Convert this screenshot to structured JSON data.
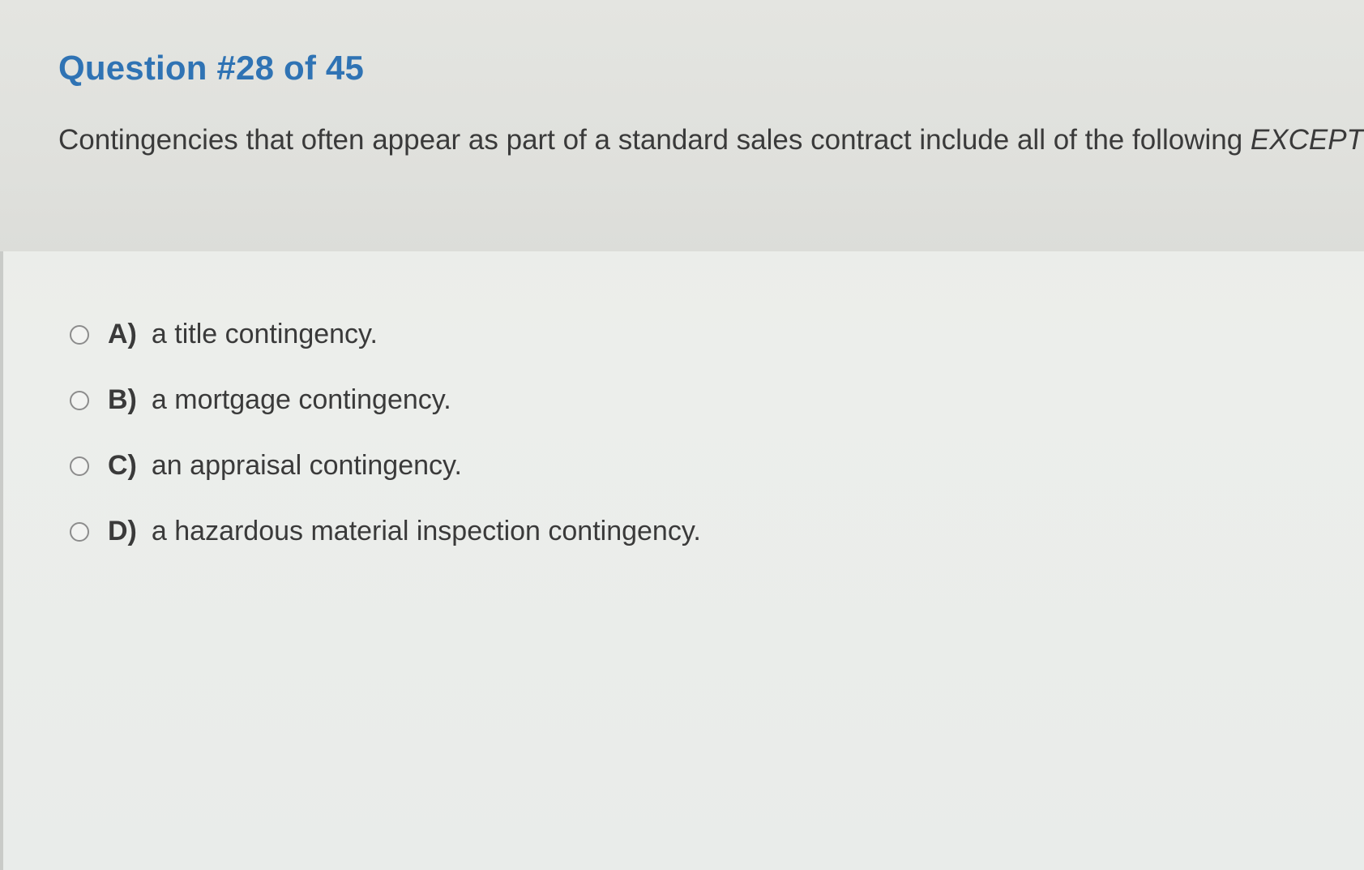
{
  "question": {
    "title": "Question #28 of 45",
    "text_main": "Contingencies that often appear as part of a standard sales contract include all of the following ",
    "text_emphasis": "EXCEPT"
  },
  "answers": [
    {
      "letter": "A)",
      "text": "a title contingency."
    },
    {
      "letter": "B)",
      "text": "a mortgage contingency."
    },
    {
      "letter": "C)",
      "text": "an appraisal contingency."
    },
    {
      "letter": "D)",
      "text": "a hazardous material inspection contingency."
    }
  ],
  "colors": {
    "title": "#2f73b4",
    "text": "#3a3a3a",
    "header_background": "#e2e3df",
    "page_background": "#eceeeb",
    "radio_border": "#8c8c8c"
  }
}
